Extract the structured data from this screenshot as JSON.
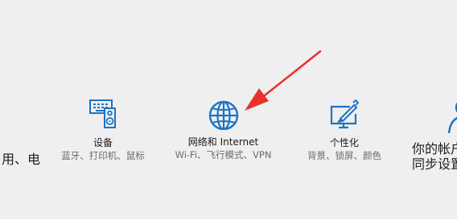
{
  "settings_home": {
    "tiles": {
      "partial_left": {
        "desc": "用、电"
      },
      "devices": {
        "title": "设备",
        "desc": "蓝牙、打印机、鼠标",
        "icon": "devices-icon"
      },
      "network": {
        "title": "网络和 Internet",
        "desc": "Wi-Fi、飞行模式、VPN",
        "icon": "globe-icon"
      },
      "personalization": {
        "title": "个性化",
        "desc": "背景、锁屏、颜色",
        "icon": "personalization-icon"
      },
      "accounts": {
        "desc_line1": "你的帐户",
        "desc_line2": "同步设置",
        "icon": "person-icon"
      }
    },
    "annotation": {
      "arrow_color": "#e8322c"
    },
    "colors": {
      "accent": "#1a74c7",
      "background": "#efefef"
    }
  }
}
